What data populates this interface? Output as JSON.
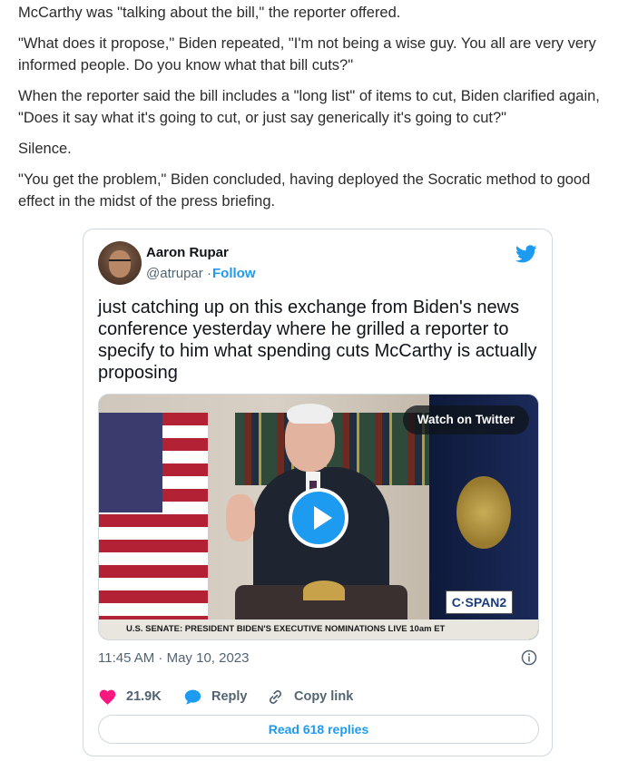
{
  "article": {
    "paragraphs": [
      "McCarthy was \"talking about the bill,\" the reporter offered.",
      "\"What does it propose,\" Biden repeated, \"I'm not being a wise guy. You all are very very informed people. Do you know what that bill cuts?\"",
      "When the reporter said the bill includes a \"long list\" of items to cut, Biden clarified again, \"Does it say what it's going to cut, or just say generically it's going to cut?\"",
      "Silence.",
      "\"You get the problem,\" Biden concluded, having deployed the Socratic method to good effect in the midst of the press briefing."
    ]
  },
  "tweet": {
    "author_name": "Aaron Rupar",
    "handle": "@atrupar",
    "separator": "·",
    "follow_label": "Follow",
    "text": "just catching up on this exchange from Biden's news conference yesterday where he grilled a reporter to specify to him what spending cuts McCarthy is actually proposing",
    "media": {
      "watch_label": "Watch on Twitter",
      "network_logo": "C·SPAN2",
      "caption": "U.S. SENATE: PRESIDENT BIDEN'S EXECUTIVE NOMINATIONS  LIVE 10am ET"
    },
    "timestamp": "11:45 AM · May 10, 2023",
    "likes": "21.9K",
    "reply_label": "Reply",
    "copy_link_label": "Copy link",
    "read_replies_label": "Read 618 replies",
    "colors": {
      "accent": "#1d9bf0",
      "like": "#f91880",
      "muted": "#536471",
      "border": "#cfd9de"
    },
    "icons": [
      "twitter-bird-icon",
      "play-icon",
      "info-icon",
      "heart-icon",
      "reply-icon",
      "link-icon"
    ]
  }
}
